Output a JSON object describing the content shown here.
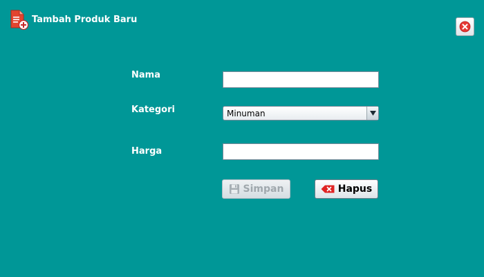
{
  "window": {
    "title": "Tambah Produk Baru",
    "icon": "document-add-icon",
    "close_icon": "close-icon"
  },
  "form": {
    "nama": {
      "label": "Nama",
      "value": ""
    },
    "kategori": {
      "label": "Kategori",
      "selected": "Minuman",
      "dropdown_icon": "chevron-down-icon"
    },
    "harga": {
      "label": "Harga",
      "value": ""
    }
  },
  "buttons": {
    "simpan": {
      "label": "Simpan",
      "icon": "save-icon",
      "enabled": false
    },
    "hapus": {
      "label": "Hapus",
      "icon": "delete-icon",
      "enabled": true
    }
  },
  "colors": {
    "background": "#009797",
    "text": "#ffffff",
    "close_red": "#e53935",
    "delete_red": "#e02424"
  }
}
